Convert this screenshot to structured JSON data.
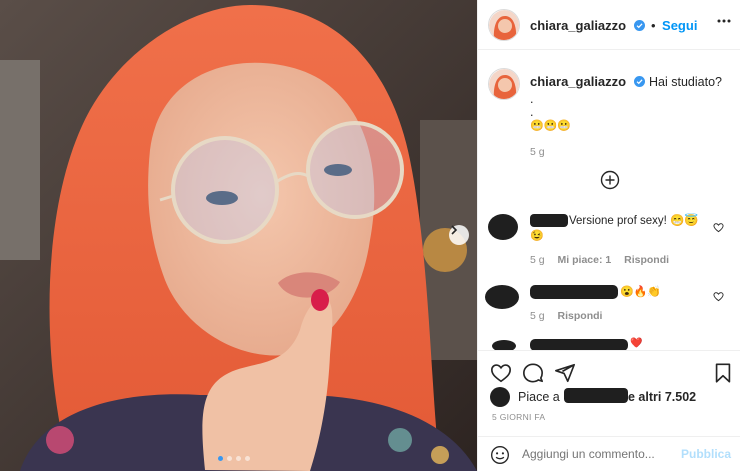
{
  "post": {
    "username": "chiara_galiazzo",
    "follow_label": "Segui",
    "caption_text": "Hai studiato?",
    "caption_dot1": ".",
    "caption_dot2": ".",
    "caption_emoji": "😬😬😬",
    "caption_age": "5 g",
    "more_replies_icon": "plus-circle-icon"
  },
  "comments": [
    {
      "text": "Versione prof sexy! 😁😇",
      "text_line2": "😉",
      "age": "5 g",
      "likes_label": "Mi piace: 1",
      "reply_label": "Rispondi"
    },
    {
      "text": "😮🔥👏",
      "age": "5 g",
      "reply_label": "Rispondi"
    },
    {
      "text": "❤️"
    }
  ],
  "actions": {
    "likes_prefix": "Piace a",
    "likes_suffix": "e altri 7.502",
    "time_ago": "5 GIORNI FA"
  },
  "comment_bar": {
    "placeholder": "Aggiungi un commento...",
    "publish_label": "Pubblica"
  },
  "carousel": {
    "slides": 4,
    "active_slide": 1
  },
  "colors": {
    "accent": "#0095f6",
    "verified": "#3897f0",
    "hair": "#e8643c"
  }
}
